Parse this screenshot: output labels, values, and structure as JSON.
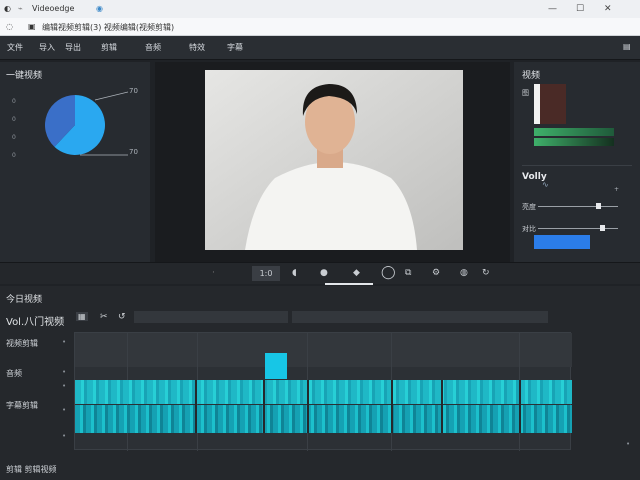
{
  "window": {
    "app_name": "Videoedge",
    "tab_text": "编辑视频剪辑(3) 视频编辑(视频剪辑)",
    "min_icon": "minimize-icon",
    "max_icon": "maximize-icon",
    "close_icon": "close-icon"
  },
  "address": {
    "text": "编辑视频剪辑(3) 视频编辑(视频剪辑)"
  },
  "toolbar": {
    "items": [
      "文件",
      "导入",
      "导出",
      "剪辑",
      "音频",
      "特效",
      "字幕"
    ]
  },
  "left_panel": {
    "title": "一键视频",
    "pie_label_top": "70",
    "pie_label_bottom": "70",
    "axis": [
      "0",
      "0",
      "0",
      "0"
    ],
    "slices": [
      {
        "value": 0.62,
        "color": "#2aa8f0"
      },
      {
        "value": 0.38,
        "color": "#3a6fc8"
      }
    ]
  },
  "right_panel": {
    "title": "视频",
    "label_a": "图",
    "section": "Volly",
    "slider1_label": "亮度",
    "slider2_label": "对比",
    "slider1_value": 0.72,
    "slider2_value": 0.78,
    "accent": "#2b7de9"
  },
  "transport": {
    "time": "1:0",
    "icons": [
      "speaker-icon",
      "record-icon",
      "diamond-icon",
      "circle-icon",
      "copy-icon",
      "settings-icon",
      "volume-icon",
      "loop-icon"
    ]
  },
  "timeline": {
    "section_title": "今日视频",
    "project_label": "Vol.八门视频",
    "tracks": [
      "视频剪辑",
      "音频",
      "字幕剪辑"
    ]
  },
  "status": {
    "text": "剪辑 剪辑视频"
  }
}
